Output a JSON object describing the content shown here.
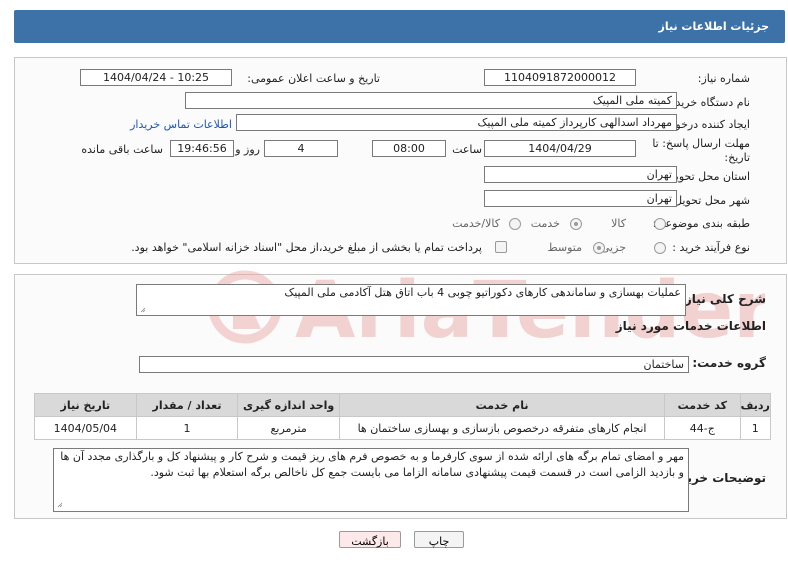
{
  "header": {
    "title": "جزئیات اطلاعات نیاز"
  },
  "fields": {
    "need_number_label": "شماره نیاز:",
    "need_number": "1104091872000012",
    "announce_label": "تاریخ و ساعت اعلان عمومی:",
    "announce_value": "1404/04/24 - 10:25",
    "buyer_org_label": "نام دستگاه خریدار:",
    "buyer_org": "کمیته ملی المپیک",
    "requester_label": "ایجاد کننده درخواست:",
    "requester": "مهرداد اسدالهی کارپرداز کمیته ملی المپیک",
    "contact_link": "اطلاعات تماس خریدار",
    "deadline_label_1": "مهلت ارسال پاسخ: تا",
    "deadline_label_2": "تاریخ:",
    "deadline_date": "1404/04/29",
    "time_label": "ساعت",
    "deadline_time": "08:00",
    "days_value": "4",
    "days_label": "روز و",
    "remaining_time": "19:46:56",
    "remaining_label": "ساعت باقی مانده",
    "province_label": "استان محل تحویل:",
    "province": "تهران",
    "city_label": "شهر محل تحویل:",
    "city": "تهران",
    "category_label": "طبقه بندی موضوعی:",
    "category_options": [
      "کالا",
      "خدمت",
      "کالا/خدمت"
    ],
    "category_selected": "خدمت",
    "process_label": "نوع فرآیند خرید :",
    "process_options": [
      "جزیی",
      "متوسط"
    ],
    "process_selected": "متوسط",
    "payment_note": "پرداخت تمام یا بخشی از مبلغ خرید،از محل \"اسناد خزانه اسلامی\" خواهد بود."
  },
  "summary": {
    "label": "شرح کلی نیاز:",
    "text": "عملیات بهسازی و ساماندهی کارهای دکوراتیو چوبی 4 باب اتاق هتل آکادمی ملی المپیک"
  },
  "services": {
    "section_title": "اطلاعات خدمات مورد نیاز",
    "group_label": "گروه خدمت:",
    "group_value": "ساختمان",
    "table": {
      "headers": [
        "ردیف",
        "کد خدمت",
        "نام خدمت",
        "واحد اندازه گیری",
        "تعداد / مقدار",
        "تاریخ نیاز"
      ],
      "rows": [
        [
          "1",
          "ج-44",
          "انجام کارهای متفرقه درخصوص بازسازی و بهسازی ساختمان ها",
          "مترمربع",
          "1",
          "1404/05/04"
        ]
      ]
    }
  },
  "buyer_notes": {
    "label": "توضیحات خریدار:",
    "text": "مهر و امضای تمام برگه های ارائه شده از سوی کارفرما و به خصوص فرم های ریز قیمت و شرح کار و پیشنهاد کل و بارگذاری مجدد آن ها و بازدید الزامی است در قسمت قیمت پیشنهادی سامانه الزاما می بایست جمع کل ناخالص برگه استعلام بها ثبت شود."
  },
  "buttons": {
    "print": "چاپ",
    "back": "بازگشت"
  },
  "watermark": {
    "text": "AriaTender.neT"
  },
  "colors": {
    "header_bg": "#3d72a8",
    "link": "#1a56c4",
    "back_button_bg": "#fde8ea",
    "watermark": "#e8a0a0"
  }
}
